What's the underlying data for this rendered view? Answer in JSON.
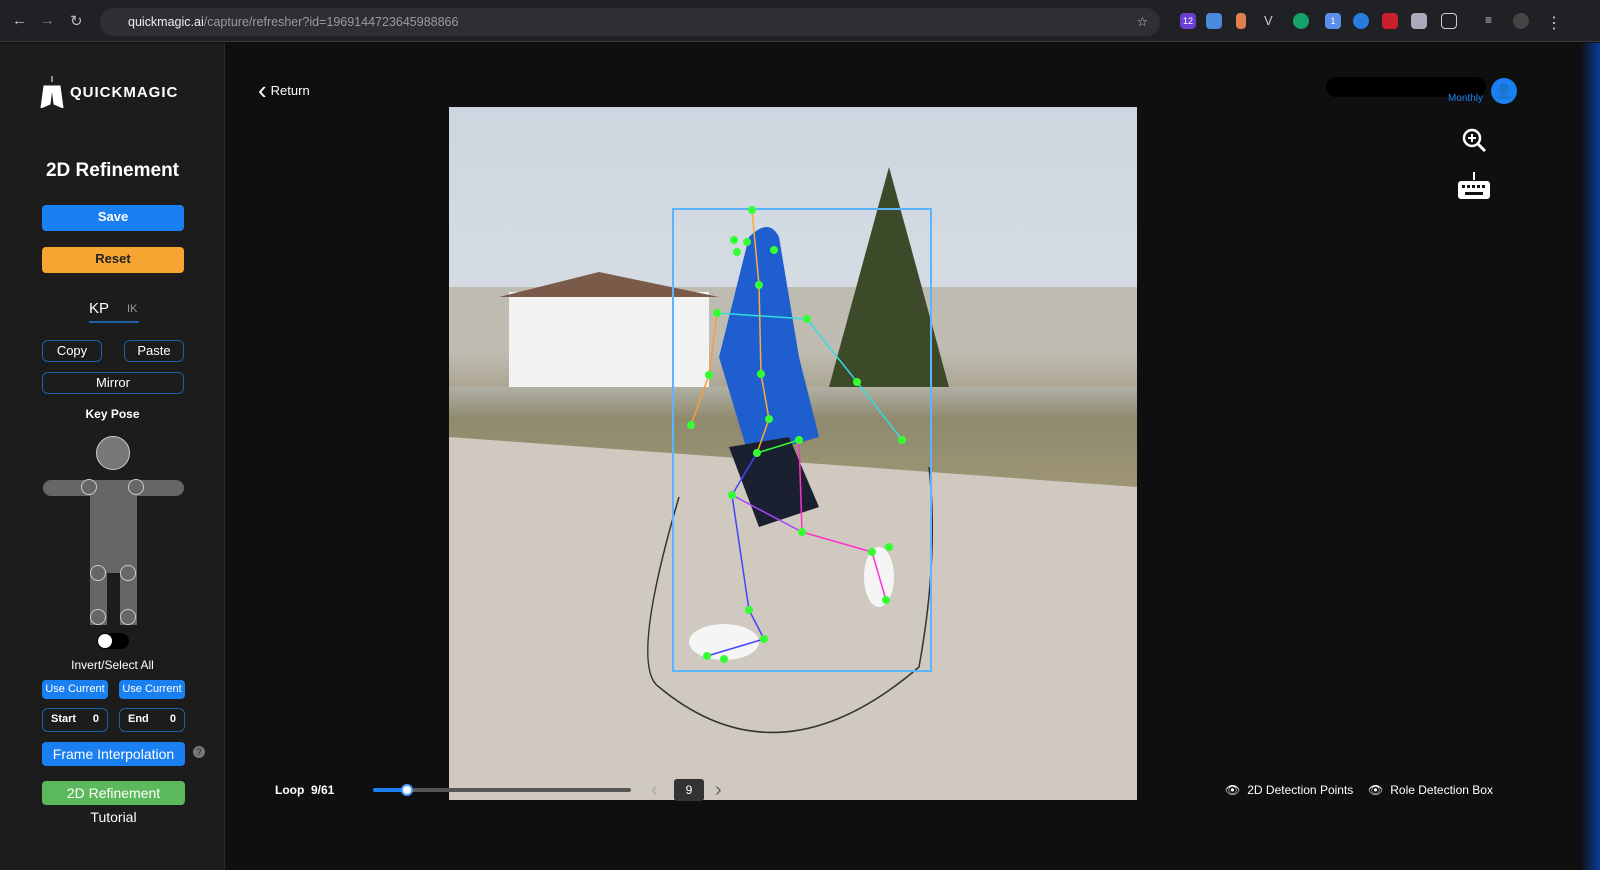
{
  "browser": {
    "url_domain": "quickmagic.ai",
    "url_path": "/capture/refresher?id=1969144723645988866",
    "ext_badges": [
      "12",
      "1"
    ]
  },
  "sidebar": {
    "logo": "QUICKMAGIC",
    "title": "2D Refinement",
    "save": "Save",
    "reset": "Reset",
    "tabs": [
      "KP",
      "IK"
    ],
    "copy": "Copy",
    "paste": "Paste",
    "mirror": "Mirror",
    "key_pose": "Key Pose",
    "invert": "Invert/Select All",
    "use_current_1": "Use Current",
    "use_current_2": "Use Current",
    "start_label": "Start",
    "start_value": "0",
    "end_label": "End",
    "end_value": "0",
    "frame_interp": "Frame Interpolation",
    "help": "?",
    "tutorial": "2D Refinement Tutorial"
  },
  "header": {
    "return": "Return",
    "plan": "Monthly"
  },
  "player": {
    "loop_label": "Loop",
    "frame_counter": "9/61",
    "frame": "9",
    "progress": 0.131,
    "detection_points": "2D Detection Points",
    "role_box": "Role Detection Box"
  },
  "colors": {
    "accent": "#1a7ff0",
    "reset": "#f7a531",
    "tutorial": "#5cb85c",
    "bbox": "#5ab4ff",
    "keypoint": "#33ff33"
  }
}
